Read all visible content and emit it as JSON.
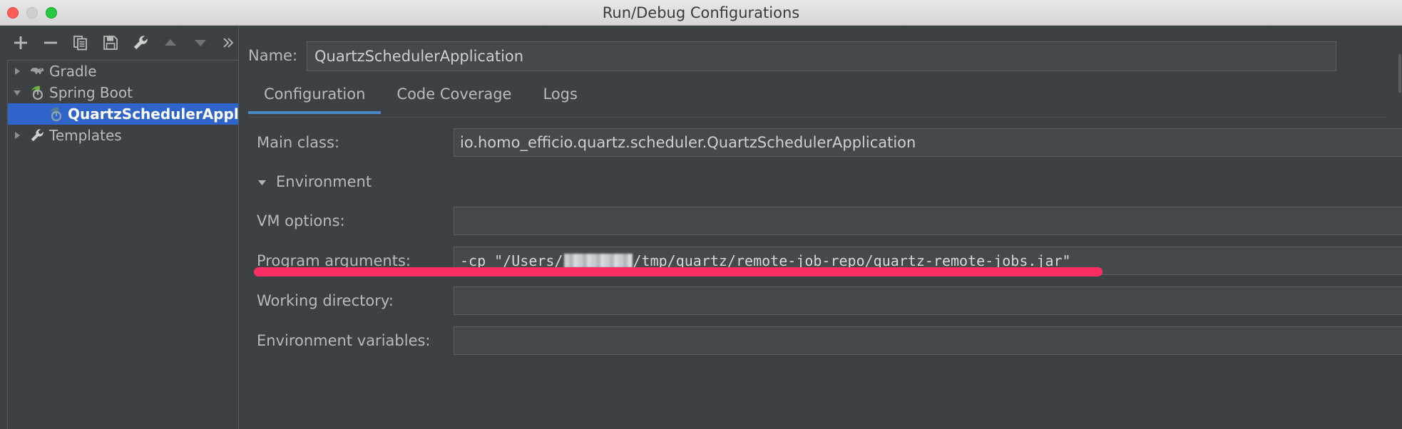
{
  "window": {
    "title": "Run/Debug Configurations",
    "controls": [
      "close-button",
      "minimize-button",
      "maximize-button"
    ]
  },
  "toolbar": {
    "buttons": [
      {
        "name": "add-configuration-button",
        "icon": "plus-icon"
      },
      {
        "name": "remove-configuration-button",
        "icon": "minus-icon"
      },
      {
        "name": "copy-configuration-button",
        "icon": "copy-icon"
      },
      {
        "name": "save-configuration-button",
        "icon": "save-icon"
      },
      {
        "name": "edit-templates-button",
        "icon": "wrench-icon"
      },
      {
        "name": "move-up-button",
        "icon": "triangle-up-icon"
      },
      {
        "name": "move-down-button",
        "icon": "triangle-down-icon"
      },
      {
        "name": "more-options-button",
        "icon": "chevron-double-right-icon"
      }
    ]
  },
  "sidebar": {
    "items": [
      {
        "label": "Gradle",
        "icon": "gradle-elephant-icon",
        "expanded": false,
        "selected": false,
        "level": 0
      },
      {
        "label": "Spring Boot",
        "icon": "spring-boot-leaf-icon",
        "expanded": true,
        "selected": false,
        "level": 0
      },
      {
        "label": "QuartzSchedulerApplic",
        "icon": "spring-boot-leaf-icon",
        "expanded": null,
        "selected": true,
        "level": 1
      },
      {
        "label": "Templates",
        "icon": "wrench-icon",
        "expanded": false,
        "selected": false,
        "level": 0
      }
    ]
  },
  "main": {
    "name_label": "Name:",
    "name_value": "QuartzSchedulerApplication",
    "name_placeholder": "",
    "tabs": [
      {
        "label": "Configuration",
        "active": true
      },
      {
        "label": "Code Coverage",
        "active": false
      },
      {
        "label": "Logs",
        "active": false
      }
    ],
    "fields": [
      {
        "label": "Main class:",
        "value": "io.homo_efficio.quartz.scheduler.QuartzSchedulerApplication",
        "mono": false
      },
      {
        "label": "VM options:",
        "value": "",
        "mono": false
      },
      {
        "label": "Working directory:",
        "value": "",
        "mono": false
      },
      {
        "label": "Environment variables:",
        "value": "",
        "mono": false
      }
    ],
    "environment_section_label": "Environment",
    "program_arguments": {
      "label": "Program arguments:",
      "prefix": "-cp \"/Users/",
      "redacted": "redacted-username",
      "suffix": "/tmp/quartz/remote-job-repo/quartz-remote-jobs.jar\""
    }
  },
  "annotation": {
    "highlighter_color": "#fb2e63",
    "highlighter_target": "program-arguments-field"
  },
  "colors": {
    "window_chrome": "#dedede",
    "panel_bg": "#3c4144",
    "input_bg": "#45494b",
    "selection_blue": "#2f65ca",
    "tab_accent": "#4a88c7",
    "text_primary": "#cfcfcf",
    "text_label": "#b9b9b9"
  }
}
